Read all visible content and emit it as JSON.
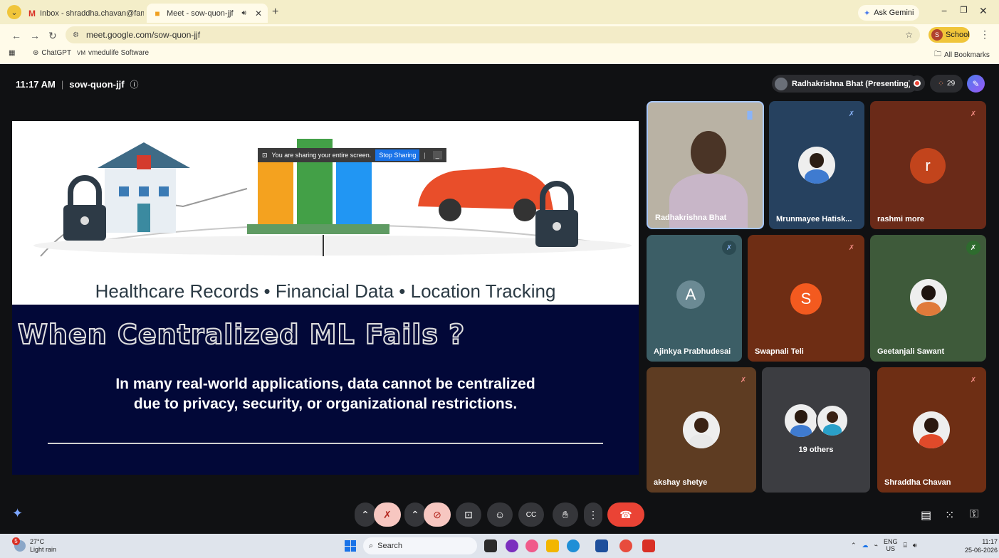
{
  "browser": {
    "tabs": [
      {
        "title": "Inbox - shraddha.chavan@famt",
        "favicon": "gmail-icon"
      },
      {
        "title": "Meet - sow-quon-jjf",
        "favicon": "meet-icon",
        "active": true
      }
    ],
    "ask_gemini": "Ask Gemini",
    "url": "meet.google.com/sow-quon-jjf",
    "profile_label": "School",
    "profile_initial": "S",
    "bookmarks": [
      "ChatGPT",
      "vmedulife Software"
    ],
    "all_bookmarks": "All Bookmarks"
  },
  "meet": {
    "time": "11:17 AM",
    "separator": "|",
    "code": "sow-quon-jjf",
    "presenter_label": "Radhakrishna Bhat (Presenting)",
    "participant_count": "29"
  },
  "slide": {
    "share_notice": "You are sharing your entire screen.",
    "stop_sharing": "Stop Sharing",
    "subtitle": "Healthcare Records  •  Financial Data  •  Location Tracking",
    "title": "When Centralized ML Fails ?",
    "body": "In many real-world applications, data cannot be centralized due to privacy, security, or organizational restrictions."
  },
  "tiles": [
    {
      "name": "Radhakrishna Bhat"
    },
    {
      "name": "Mrunmayee Hatisk..."
    },
    {
      "name": "rashmi more",
      "initial": "r"
    },
    {
      "name": "Ajinkya Prabhudesai",
      "initial": "A"
    },
    {
      "name": "Swapnali Teli",
      "initial": "S"
    },
    {
      "name": "Geetanjali Sawant"
    },
    {
      "name": "akshay shetye"
    },
    {
      "name": "19 others"
    },
    {
      "name": "Shraddha Chavan"
    }
  ],
  "taskbar": {
    "weather_temp": "27°C",
    "weather_desc": "Light rain",
    "weather_badge": "5",
    "search_placeholder": "Search",
    "lang_top": "ENG",
    "lang_bottom": "US",
    "time": "11:17",
    "date": "25-06-2026"
  },
  "colors": {
    "meet_bg": "#101113",
    "slide_dark": "#020838",
    "hangup": "#ea4335",
    "chrome_bar": "#f4eec9"
  }
}
